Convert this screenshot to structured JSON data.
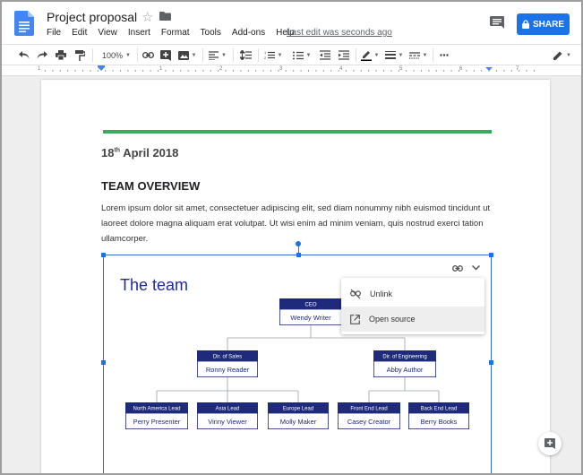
{
  "app": {
    "doc_title": "Project proposal",
    "last_edit": "Last edit was seconds ago",
    "share_label": "SHARE",
    "brand_color": "#1a73e8"
  },
  "menu": [
    "File",
    "Edit",
    "View",
    "Insert",
    "Format",
    "Tools",
    "Add-ons",
    "Help"
  ],
  "toolbar": {
    "zoom": "100%",
    "icons": [
      "undo-icon",
      "redo-icon",
      "print-icon",
      "paint-format-icon",
      "link-icon",
      "insert-comment-icon",
      "insert-image-icon",
      "align-icon",
      "line-spacing-icon",
      "numbered-list-icon",
      "bulleted-list-icon",
      "decrease-indent-icon",
      "increase-indent-icon",
      "pen-color-icon",
      "border-weight-icon",
      "border-dash-icon",
      "more-icon",
      "editing-mode-icon"
    ]
  },
  "ruler": {
    "numbers": [
      "1",
      "1",
      "2",
      "3",
      "4",
      "5",
      "6",
      "7"
    ]
  },
  "document": {
    "date_day": "18",
    "date_suffix": "th",
    "date_rest": "April 2018",
    "heading": "TEAM OVERVIEW",
    "paragraph": "Lorem ipsum dolor sit amet, consectetuer adipiscing elit, sed diam nonummy nibh euismod tincidunt ut laoreet dolore magna aliquam erat volutpat. Ut wisi enim ad minim veniam, quis nostrud exerci tation ullamcorper.",
    "accent_color": "#3aab5c"
  },
  "org_chart": {
    "title": "The team",
    "header_color": "#1f2a7a",
    "nodes": [
      {
        "id": "ceo",
        "role": "CEO",
        "name": "Wendy Writer"
      },
      {
        "id": "sales",
        "role": "Dir. of Sales",
        "name": "Ronny Reader"
      },
      {
        "id": "eng",
        "role": "Dir. of Engineering",
        "name": "Abby Author"
      },
      {
        "id": "na",
        "role": "North America Lead",
        "name": "Perry Presenter"
      },
      {
        "id": "asia",
        "role": "Asia Lead",
        "name": "Vinny Viewer"
      },
      {
        "id": "eu",
        "role": "Europe Lead",
        "name": "Molly Maker"
      },
      {
        "id": "fe",
        "role": "Front End Lead",
        "name": "Casey Creator"
      },
      {
        "id": "be",
        "role": "Back End Lead",
        "name": "Berry Books"
      }
    ]
  },
  "link_menu": {
    "items": [
      {
        "label": "Unlink",
        "icon": "unlink-icon"
      },
      {
        "label": "Open source",
        "icon": "open-source-icon"
      }
    ]
  }
}
